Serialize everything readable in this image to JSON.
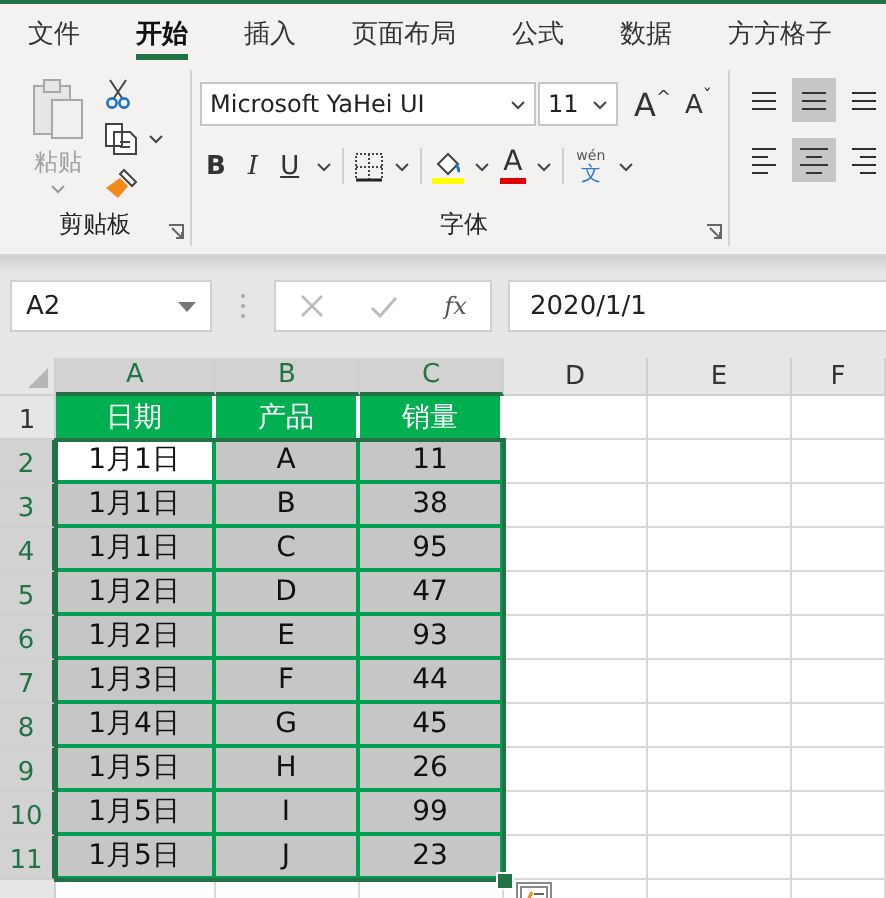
{
  "tabs": [
    {
      "label": "文件",
      "selected": false
    },
    {
      "label": "开始",
      "selected": true
    },
    {
      "label": "插入",
      "selected": false
    },
    {
      "label": "页面布局",
      "selected": false
    },
    {
      "label": "公式",
      "selected": false
    },
    {
      "label": "数据",
      "selected": false
    },
    {
      "label": "方方格子",
      "selected": false
    }
  ],
  "clipboard": {
    "paste_label": "粘贴",
    "paste_disabled": true,
    "group_label": "剪贴板"
  },
  "font": {
    "name": "Microsoft YaHei UI",
    "size": "11",
    "grow": "A",
    "grow_mark": "^",
    "shrink": "A",
    "shrink_mark": "ˇ",
    "bold": "B",
    "italic": "I",
    "underline": "U",
    "font_color": "A",
    "phonetic_top": "wén",
    "phonetic_bottom": "文",
    "group_label": "字体"
  },
  "alignment": [
    {
      "kind": "top",
      "selected": false
    },
    {
      "kind": "middle",
      "selected": true
    },
    {
      "kind": "bottom",
      "selected": false
    },
    {
      "kind": "left",
      "selected": false
    },
    {
      "kind": "center",
      "selected": true
    },
    {
      "kind": "right",
      "selected": false
    }
  ],
  "formula_bar": {
    "name_box": "A2",
    "fx": "fx",
    "value": "2020/1/1"
  },
  "columns": [
    {
      "label": "A",
      "selected": true
    },
    {
      "label": "B",
      "selected": true
    },
    {
      "label": "C",
      "selected": true
    },
    {
      "label": "D",
      "selected": false
    },
    {
      "label": "E",
      "selected": false
    },
    {
      "label": "F",
      "selected": false
    }
  ],
  "rows": [
    {
      "number": "1",
      "selected": false,
      "kind": "header",
      "cells": [
        {
          "text": "日期"
        },
        {
          "text": "产品"
        },
        {
          "text": "销量"
        }
      ]
    },
    {
      "number": "2",
      "selected": true,
      "kind": "data",
      "cells": [
        {
          "text": "1月1日",
          "active": true
        },
        {
          "text": "A",
          "active": false
        },
        {
          "text": "11",
          "active": false
        }
      ]
    },
    {
      "number": "3",
      "selected": true,
      "kind": "data",
      "cells": [
        {
          "text": "1月1日",
          "active": false
        },
        {
          "text": "B",
          "active": false
        },
        {
          "text": "38",
          "active": false
        }
      ]
    },
    {
      "number": "4",
      "selected": true,
      "kind": "data",
      "cells": [
        {
          "text": "1月1日",
          "active": false
        },
        {
          "text": "C",
          "active": false
        },
        {
          "text": "95",
          "active": false
        }
      ]
    },
    {
      "number": "5",
      "selected": true,
      "kind": "data",
      "cells": [
        {
          "text": "1月2日",
          "active": false
        },
        {
          "text": "D",
          "active": false
        },
        {
          "text": "47",
          "active": false
        }
      ]
    },
    {
      "number": "6",
      "selected": true,
      "kind": "data",
      "cells": [
        {
          "text": "1月2日",
          "active": false
        },
        {
          "text": "E",
          "active": false
        },
        {
          "text": "93",
          "active": false
        }
      ]
    },
    {
      "number": "7",
      "selected": true,
      "kind": "data",
      "cells": [
        {
          "text": "1月3日",
          "active": false
        },
        {
          "text": "F",
          "active": false
        },
        {
          "text": "44",
          "active": false
        }
      ]
    },
    {
      "number": "8",
      "selected": true,
      "kind": "data",
      "cells": [
        {
          "text": "1月4日",
          "active": false
        },
        {
          "text": "G",
          "active": false
        },
        {
          "text": "45",
          "active": false
        }
      ]
    },
    {
      "number": "9",
      "selected": true,
      "kind": "data",
      "cells": [
        {
          "text": "1月5日",
          "active": false
        },
        {
          "text": "H",
          "active": false
        },
        {
          "text": "26",
          "active": false
        }
      ]
    },
    {
      "number": "10",
      "selected": true,
      "kind": "data",
      "cells": [
        {
          "text": "1月5日",
          "active": false
        },
        {
          "text": "I",
          "active": false
        },
        {
          "text": "99",
          "active": false
        }
      ]
    },
    {
      "number": "11",
      "selected": true,
      "kind": "data",
      "cells": [
        {
          "text": "1月5日",
          "active": false
        },
        {
          "text": "J",
          "active": false
        },
        {
          "text": "23",
          "active": false
        }
      ]
    }
  ]
}
